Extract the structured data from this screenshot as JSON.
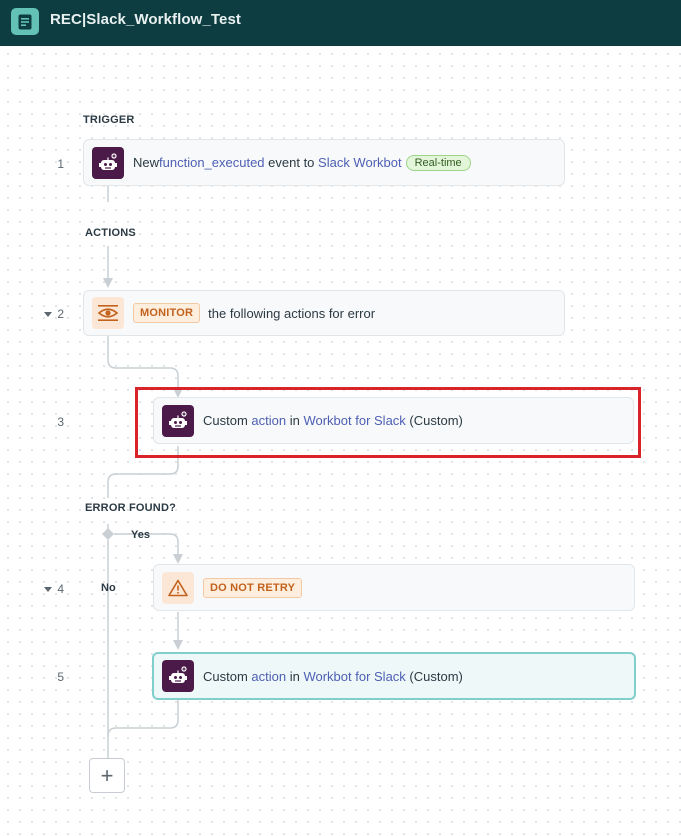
{
  "header": {
    "title": "REC|Slack_Workflow_Test",
    "icon": "document-icon",
    "colors": {
      "bar": "#0d3d40",
      "icon_bg": "#63c2b5"
    }
  },
  "sections": {
    "trigger": "TRIGGER",
    "actions": "ACTIONS",
    "error_found": "ERROR FOUND?",
    "yes": "Yes",
    "no": "No"
  },
  "steps": [
    {
      "num": "1",
      "icon": "workbot-icon",
      "parts": {
        "a": "New ",
        "b": "function_executed",
        "c": " event to ",
        "d": "Slack Workbot"
      },
      "badge": "Real-time"
    },
    {
      "num": "2",
      "icon": "monitor-eye-icon",
      "keyword": "MONITOR",
      "text": "the following actions for error"
    },
    {
      "num": "3",
      "icon": "workbot-icon",
      "parts": {
        "a": "Custom ",
        "b": "action",
        "c": " in ",
        "d": "Workbot for Slack",
        "e": " (Custom)"
      }
    },
    {
      "num": "4",
      "icon": "warning-icon",
      "keyword": "DO NOT RETRY"
    },
    {
      "num": "5",
      "icon": "workbot-icon",
      "parts": {
        "a": "Custom ",
        "b": "action",
        "c": " in ",
        "d": "Workbot for Slack",
        "e": " (Custom)"
      }
    }
  ],
  "add_button": "+",
  "colors": {
    "link": "#4d5fb3",
    "highlight": "#d9232a",
    "active_border": "#7fd0cc",
    "workbot": "#4b1a48",
    "keyword": "#c2621d"
  }
}
